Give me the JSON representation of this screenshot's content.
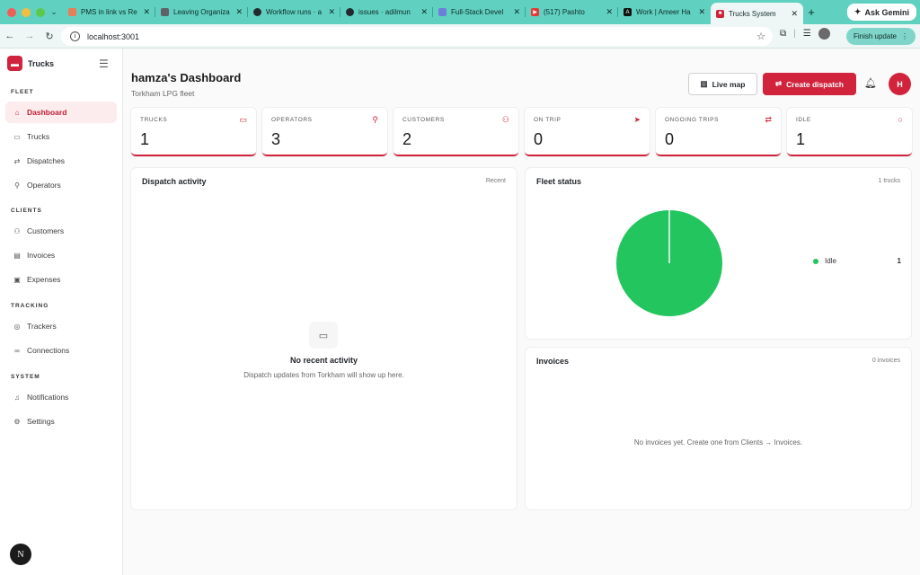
{
  "browser": {
    "tabs": [
      {
        "label": "PMS in link vs Re",
        "color": "#e67e5a"
      },
      {
        "label": "Leaving Organiza",
        "color": "#5f6368"
      },
      {
        "label": "Workflow runs · a",
        "color": "#24292f"
      },
      {
        "label": "issues · adilmun",
        "color": "#24292f"
      },
      {
        "label": "Full-Stack Devel",
        "color": "#6b7fd7"
      },
      {
        "label": "(517) Pashto",
        "color": "#e53935"
      },
      {
        "label": "Work | Ameer Ha",
        "color": "#111111"
      },
      {
        "label": "Trucks System",
        "color": "#d1233c"
      }
    ],
    "ask_gemini": "Ask Gemini",
    "url": "localhost:3001",
    "finish_update": "Finish update"
  },
  "sidebar": {
    "brand": "Trucks",
    "sections": {
      "fleet": "FLEET",
      "clients": "CLIENTS",
      "tracking": "TRACKING",
      "system": "SYSTEM"
    },
    "items": {
      "dashboard": "Dashboard",
      "trucks": "Trucks",
      "dispatches": "Dispatches",
      "operators": "Operators",
      "customers": "Customers",
      "invoices": "Invoices",
      "expenses": "Expenses",
      "trackers": "Trackers",
      "connections": "Connections",
      "notifications": "Notifications",
      "settings": "Settings"
    },
    "badge": "N"
  },
  "header": {
    "title": "hamza's Dashboard",
    "subtitle": "Torkham LPG fleet",
    "live_map": "Live map",
    "create_dispatch": "Create dispatch",
    "avatar": "H"
  },
  "stats": {
    "trucks": {
      "label": "TRUCKS",
      "value": "1"
    },
    "operators": {
      "label": "OPERATORS",
      "value": "3"
    },
    "customers": {
      "label": "CUSTOMERS",
      "value": "2"
    },
    "on_trip": {
      "label": "ON TRIP",
      "value": "0"
    },
    "ongoing": {
      "label": "ONGOING TRIPS",
      "value": "0"
    },
    "idle": {
      "label": "IDLE",
      "value": "1"
    }
  },
  "activity": {
    "title": "Dispatch activity",
    "meta": "Recent",
    "empty_title": "No recent activity",
    "empty_desc": "Dispatch updates from Torkham will show up here."
  },
  "fleet_status": {
    "title": "Fleet status",
    "meta": "1 trucks",
    "legend_label": "Idle",
    "legend_value": "1"
  },
  "invoices": {
    "title": "Invoices",
    "meta": "0 invoices",
    "empty": "No invoices yet. Create one from Clients → Invoices."
  },
  "chart_data": {
    "type": "pie",
    "title": "Fleet status",
    "categories": [
      "Idle"
    ],
    "values": [
      1
    ],
    "colors": [
      "#22c55e"
    ]
  },
  "colors": {
    "accent": "#d1233c",
    "idle": "#22c55e",
    "browser_frame": "#60d1c1"
  }
}
